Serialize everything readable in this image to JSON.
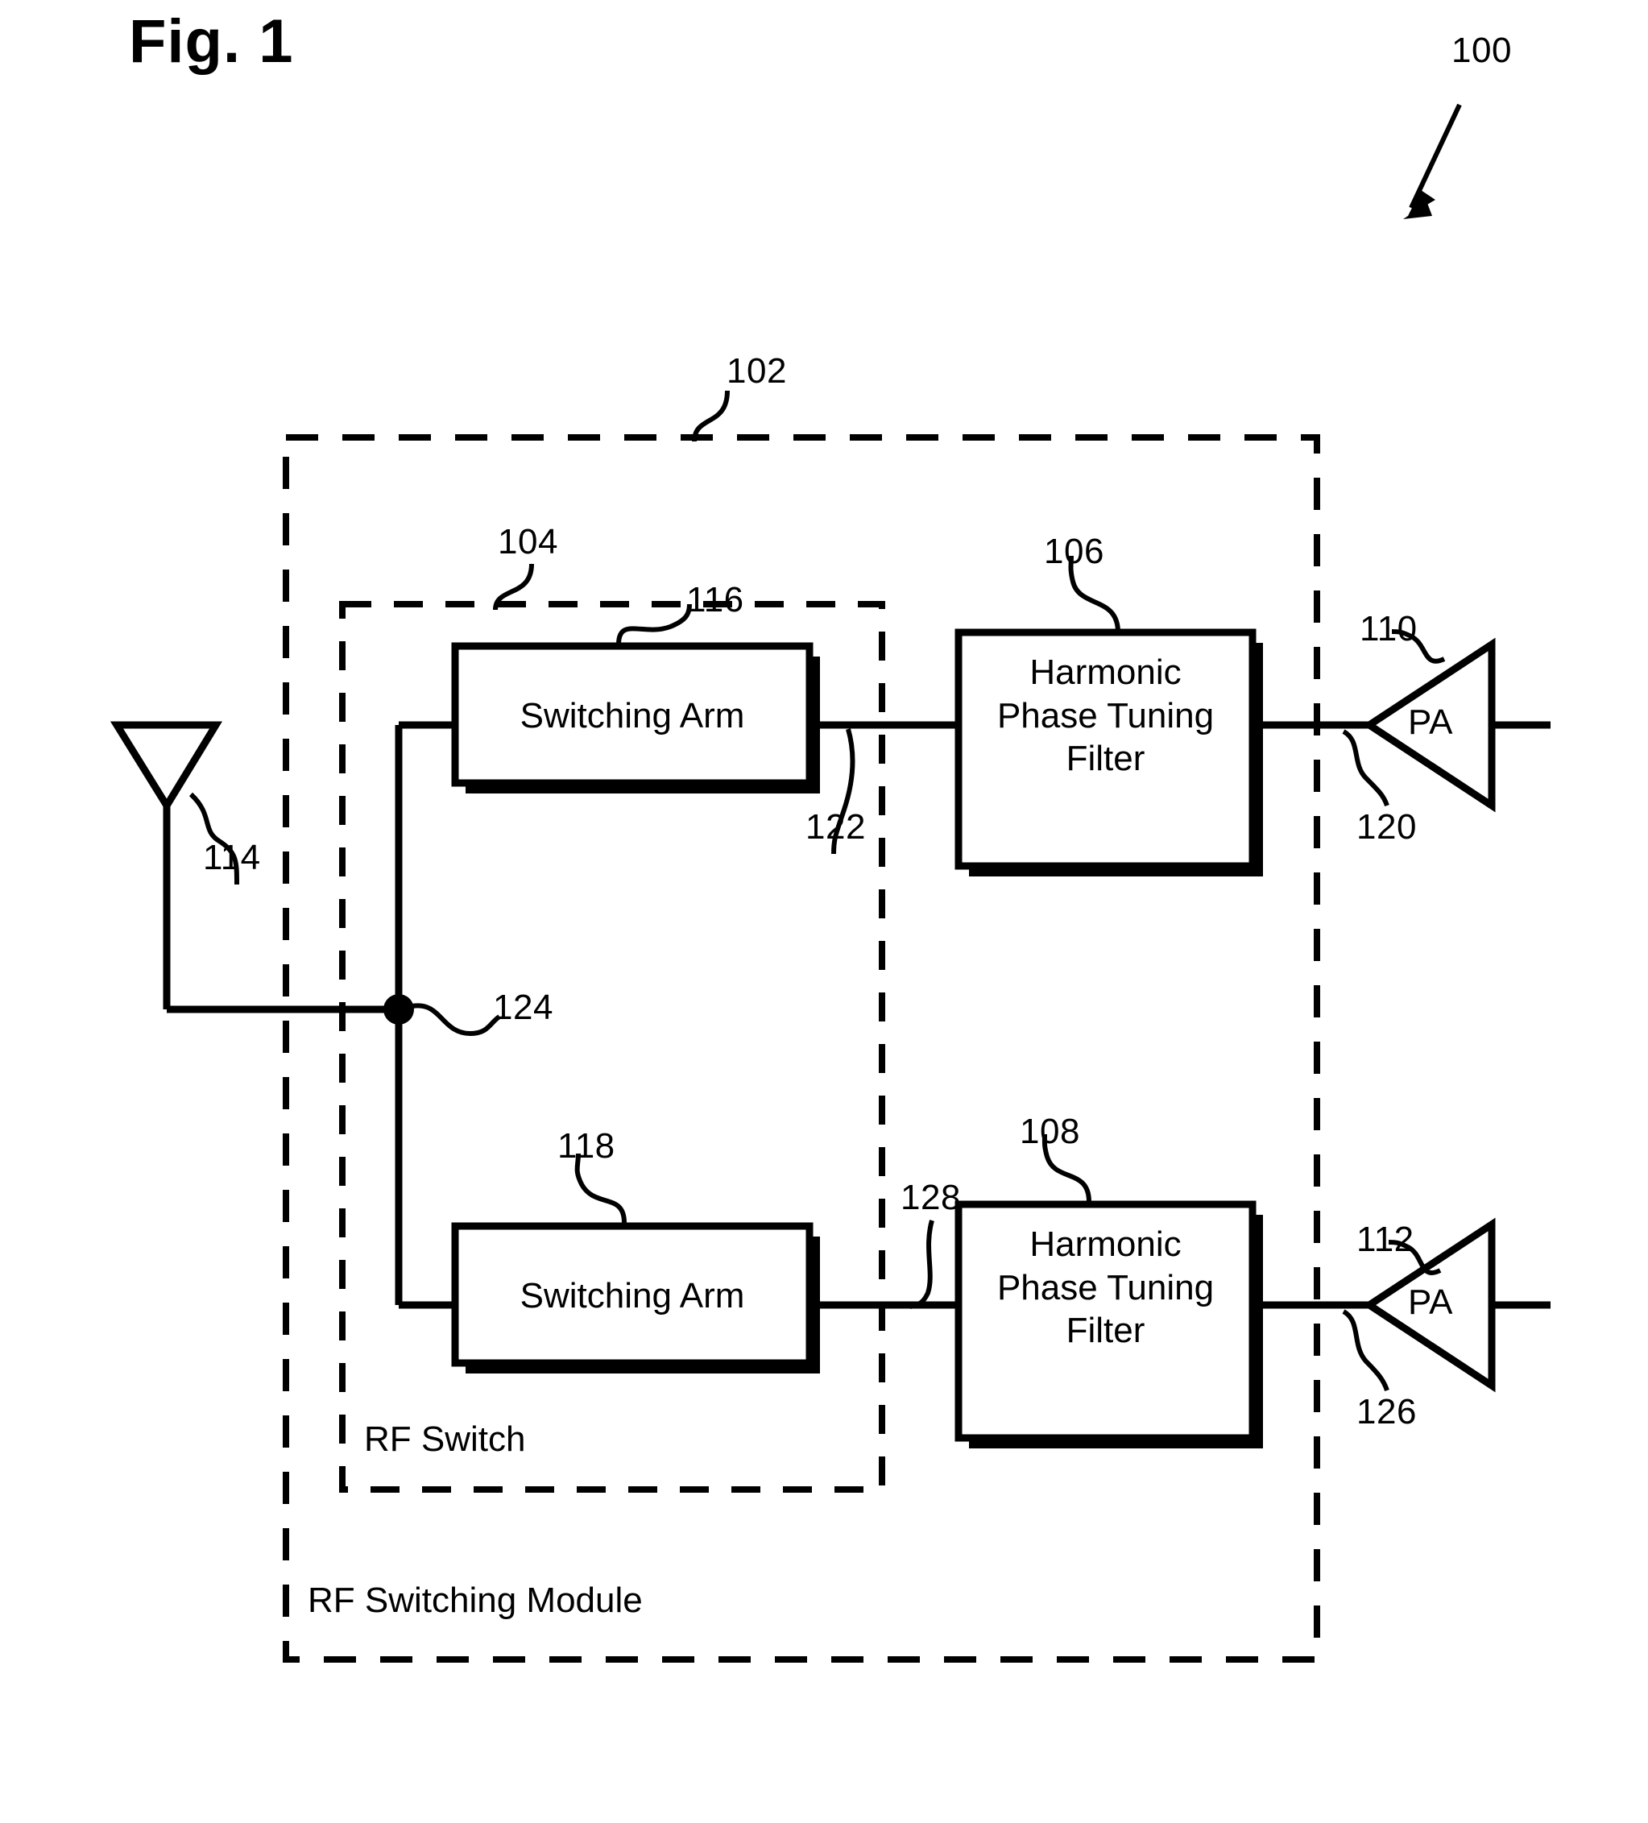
{
  "figure": {
    "title": "Fig. 1",
    "overall_ref": "100"
  },
  "containers": [
    {
      "id": "rf-switching-module",
      "label": "RF Switching Module",
      "ref": "102",
      "style": "dashed"
    },
    {
      "id": "rf-switch",
      "label": "RF Switch",
      "ref": "104",
      "style": "dashed"
    }
  ],
  "blocks": [
    {
      "id": "switching-arm-top",
      "label": "Switching Arm",
      "ref": "116"
    },
    {
      "id": "switching-arm-bottom",
      "label": "Switching Arm",
      "ref": "118"
    },
    {
      "id": "harmonic-filter-top",
      "label": "Harmonic\nPhase Tuning\nFilter",
      "ref": "106"
    },
    {
      "id": "harmonic-filter-bottom",
      "label": "Harmonic\nPhase Tuning\nFilter",
      "ref": "108"
    }
  ],
  "amplifiers": [
    {
      "id": "pa-top",
      "label": "PA",
      "ref": "110",
      "node_ref": "120"
    },
    {
      "id": "pa-bottom",
      "label": "PA",
      "ref": "112",
      "node_ref": "126"
    }
  ],
  "antenna": {
    "id": "antenna",
    "ref": "114"
  },
  "nodes": [
    {
      "id": "common-node",
      "ref": "124"
    },
    {
      "id": "signal-path-top",
      "ref": "122"
    },
    {
      "id": "signal-path-bottom",
      "ref": "128"
    }
  ],
  "colors": {
    "line": "#000000",
    "background": "#ffffff",
    "shadow": "#000000"
  }
}
